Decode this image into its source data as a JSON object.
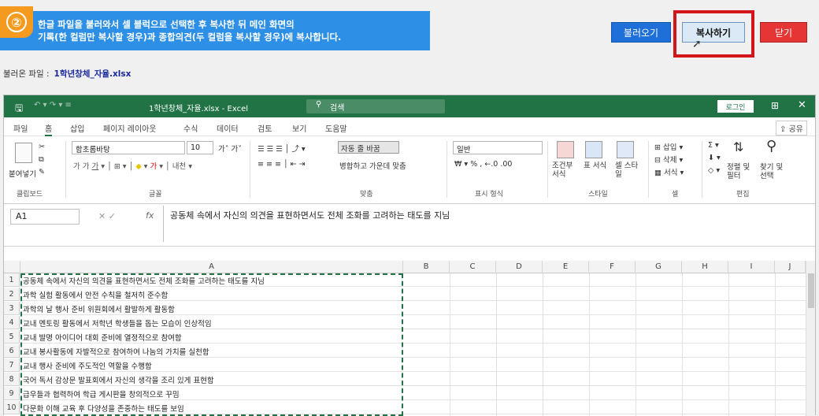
{
  "step": "②",
  "info": {
    "line1": "한글 파일을 불러와서 셀 블럭으로 선택한 후 복사한 뒤 메인 화면의",
    "line2": "기록(한 컬럼만 복사할 경우)과 종합의견(두 컬럼을 복사할 경우)에 복사합니다."
  },
  "buttons": {
    "load": "불러오기",
    "copy": "복사하기",
    "close": "닫기"
  },
  "file": {
    "label": "불러온 파일 :",
    "name": "1학년창체_자율.xlsx"
  },
  "excel": {
    "title": "1학년창체_자율.xlsx  -  Excel",
    "search": "검색",
    "login": "로그인",
    "menus": [
      "파일",
      "홈",
      "삽입",
      "페이지 레이아웃",
      "수식",
      "데이터",
      "검토",
      "보기",
      "도움말"
    ],
    "share": "공유",
    "ribbon": {
      "paste": "붙여넣기",
      "font_name": "함초롬바탕",
      "font_size": "10",
      "wrap": "자동 줄 바꿈",
      "merge": "병합하고 가운데 맞춤",
      "number_format": "일반",
      "cond_format": "조건부 서식",
      "table_format": "표 서식",
      "cell_style": "셀 스타일",
      "insert": "삽입",
      "delete": "삭제",
      "format": "서식",
      "sort": "정렬 및 필터",
      "find": "찾기 및 선택",
      "groups": [
        "클립보드",
        "글꼴",
        "맞춤",
        "표시 형식",
        "스타일",
        "셀",
        "편집"
      ]
    },
    "name_box": "A1",
    "formula": "공동체 속에서 자신의 의견을 표현하면서도 전체 조화를 고려하는 태도를 지님",
    "columns": [
      "A",
      "B",
      "C",
      "D",
      "E",
      "F",
      "G",
      "H",
      "I",
      "J"
    ],
    "rows": [
      {
        "n": "1",
        "a": "공동체 속에서 자신의 의견을 표현하면서도 전체 조화를 고려하는 태도를 지님"
      },
      {
        "n": "2",
        "a": "과학 실험 활동에서 안전 수칙을 철저히 준수함"
      },
      {
        "n": "3",
        "a": "과학의 날 행사 준비 위원회에서 활발하게 활동함"
      },
      {
        "n": "4",
        "a": "교내 멘토링 활동에서 저학년 학생들을 돕는 모습이 인상적임"
      },
      {
        "n": "5",
        "a": "교내 발명 아이디어 대회 준비에 열정적으로 참여함"
      },
      {
        "n": "6",
        "a": "교내 봉사활동에 자발적으로 참여하여 나눔의 가치를 실천함"
      },
      {
        "n": "7",
        "a": "교내 행사 준비에 주도적인 역할을 수행함"
      },
      {
        "n": "8",
        "a": "국어 독서 감상문 발표회에서 자신의 생각을 조리 있게 표현함"
      },
      {
        "n": "9",
        "a": "급우들과 협력하여 학급 게시판을 창의적으로 꾸밈"
      },
      {
        "n": "10",
        "a": "다문화 이해 교육 후 다양성을 존중하는 태도를 보임"
      }
    ]
  },
  "colors": {
    "excel_green": "#217346",
    "info_blue": "#2d90e6",
    "badge": "#f39a1f",
    "highlight": "#d4141b"
  }
}
